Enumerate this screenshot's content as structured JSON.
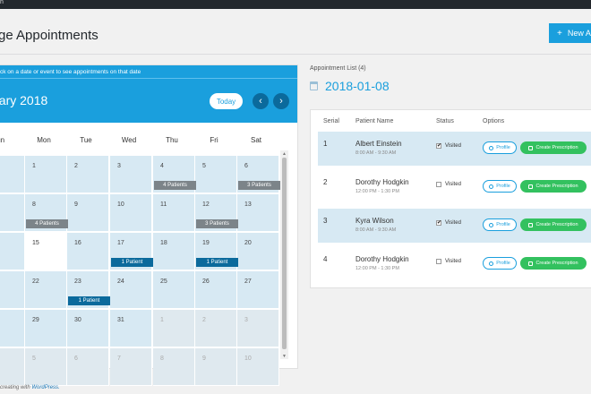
{
  "topbar": {
    "text": "n"
  },
  "page": {
    "title": "ge Appointments",
    "new_button": "New Ap"
  },
  "calendar": {
    "hint": "ck on a date or event to see appointments on that date",
    "month": "uary 2018",
    "today": "Today",
    "prev": "‹",
    "next": "›",
    "weekdays": [
      "Sun",
      "Mon",
      "Tue",
      "Wed",
      "Thu",
      "Fri",
      "Sat"
    ],
    "weeks": [
      [
        "",
        "1",
        "2",
        "3",
        "4",
        "5",
        "6"
      ],
      [
        "",
        "8",
        "9",
        "10",
        "11",
        "12",
        "13"
      ],
      [
        "",
        "15",
        "16",
        "17",
        "18",
        "19",
        "20"
      ],
      [
        "",
        "22",
        "23",
        "24",
        "25",
        "26",
        "27"
      ],
      [
        "",
        "29",
        "30",
        "31",
        "1",
        "2",
        "3"
      ],
      [
        "",
        "5",
        "6",
        "7",
        "8",
        "9",
        "10"
      ]
    ],
    "events": [
      {
        "label": "4 Patients",
        "style": "gray",
        "row": 0,
        "col": 4
      },
      {
        "label": "3 Patients",
        "style": "gray",
        "row": 0,
        "col": 6
      },
      {
        "label": "4 Patients",
        "style": "gray",
        "row": 1,
        "col": 1
      },
      {
        "label": "3 Patients",
        "style": "gray",
        "row": 1,
        "col": 5
      },
      {
        "label": "1 Patient",
        "style": "blue",
        "row": 2,
        "col": 3
      },
      {
        "label": "1 Patient",
        "style": "blue",
        "row": 2,
        "col": 5
      },
      {
        "label": "1 Patient",
        "style": "blue",
        "row": 3,
        "col": 2
      }
    ]
  },
  "appointments": {
    "label": "Appointment List (4)",
    "date": "2018-01-08",
    "headers": {
      "serial": "Serial",
      "patient": "Patient Name",
      "status": "Status",
      "options": "Options"
    },
    "rows": [
      {
        "serial": "1",
        "name": "Albert Einstein",
        "time": "8:00 AM - 9:30 AM",
        "visited": true,
        "status": "Visited",
        "profile": "Profile",
        "prescription": "Create Prescription"
      },
      {
        "serial": "2",
        "name": "Dorothy Hodgkin",
        "time": "12:00 PM - 1:30 PM",
        "visited": false,
        "status": "Visited",
        "profile": "Profile",
        "prescription": "Create Prescription"
      },
      {
        "serial": "3",
        "name": "Kyra Wilson",
        "time": "8:00 AM - 9:30 AM",
        "visited": true,
        "status": "Visited",
        "profile": "Profile",
        "prescription": "Create Prescription"
      },
      {
        "serial": "4",
        "name": "Dorothy Hodgkin",
        "time": "12:00 PM - 1:30 PM",
        "visited": false,
        "status": "Visited",
        "profile": "Profile",
        "prescription": "Create Prescription"
      }
    ]
  },
  "footer": {
    "text": "creating with ",
    "link": "WordPress."
  },
  "colors": {
    "accent": "#1a9fdd",
    "green": "#33c15f",
    "dark_blue": "#0b6a9c"
  }
}
